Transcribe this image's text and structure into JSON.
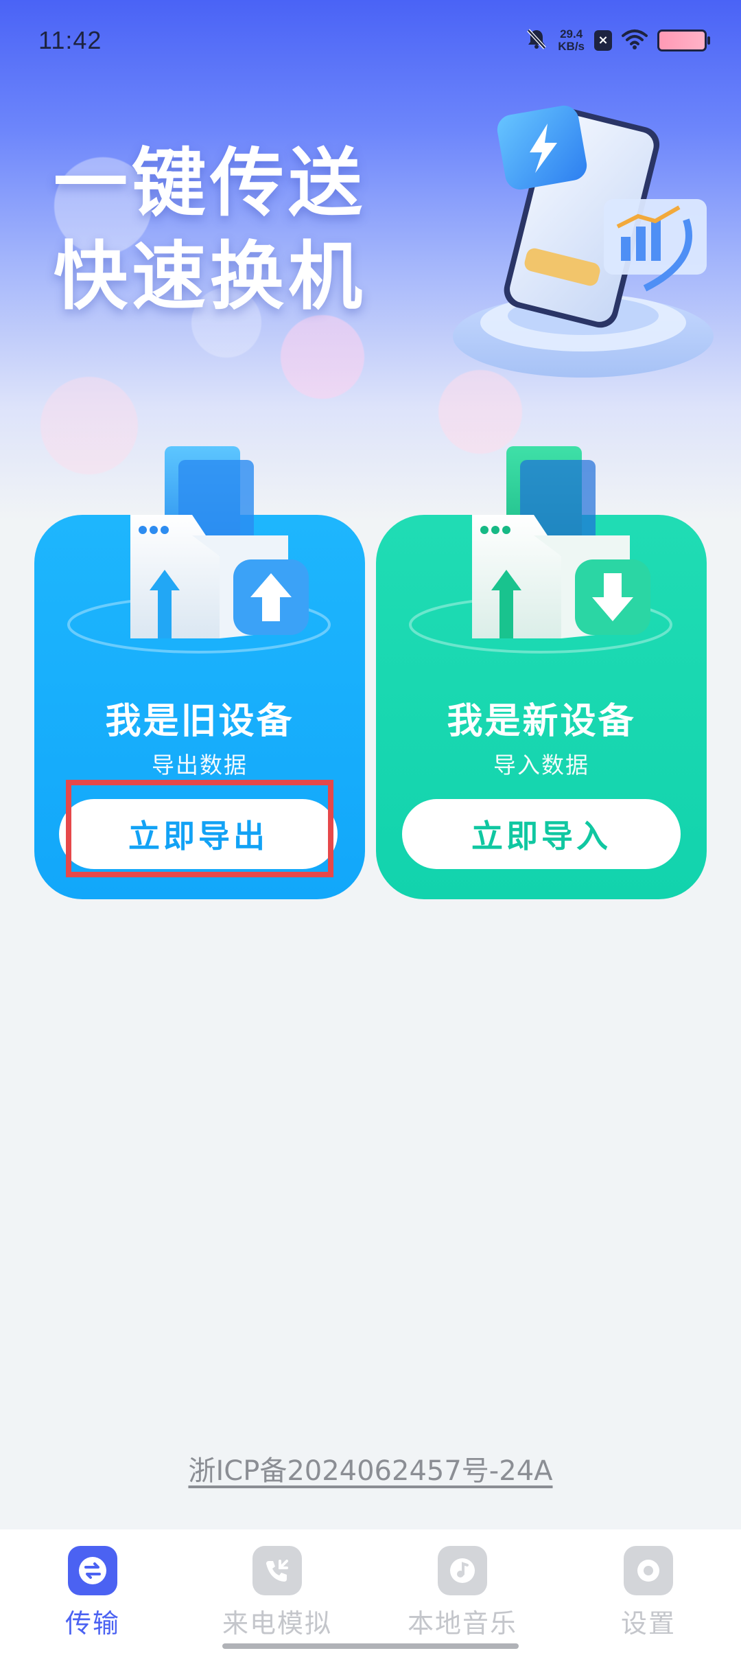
{
  "status_bar": {
    "time": "11:42",
    "network_speed_value": "29.4",
    "network_speed_unit": "KB/s",
    "icons": [
      "bell-muted-icon",
      "x-app-icon",
      "wifi-icon",
      "battery-icon"
    ]
  },
  "hero": {
    "title_line1": "一键传送",
    "title_line2": "快速换机",
    "illustration": "phone-transfer-illustration"
  },
  "cards": {
    "old_device": {
      "title": "我是旧设备",
      "subtitle": "导出数据",
      "button_label": "立即导出",
      "icon": "upload-box-icon",
      "color": "#18adfb"
    },
    "new_device": {
      "title": "我是新设备",
      "subtitle": "导入数据",
      "button_label": "立即导入",
      "icon": "download-box-icon",
      "color": "#18d6b0"
    }
  },
  "footer": {
    "icp": "浙ICP备2024062457号-24A"
  },
  "bottom_nav": {
    "items": [
      {
        "label": "传输",
        "icon": "transfer-icon",
        "active": true
      },
      {
        "label": "来电模拟",
        "icon": "incoming-call-icon",
        "active": false
      },
      {
        "label": "本地音乐",
        "icon": "music-icon",
        "active": false
      },
      {
        "label": "设置",
        "icon": "settings-icon",
        "active": false
      }
    ]
  },
  "colors": {
    "accent": "#4b62f2",
    "highlight": "#e6484a"
  }
}
